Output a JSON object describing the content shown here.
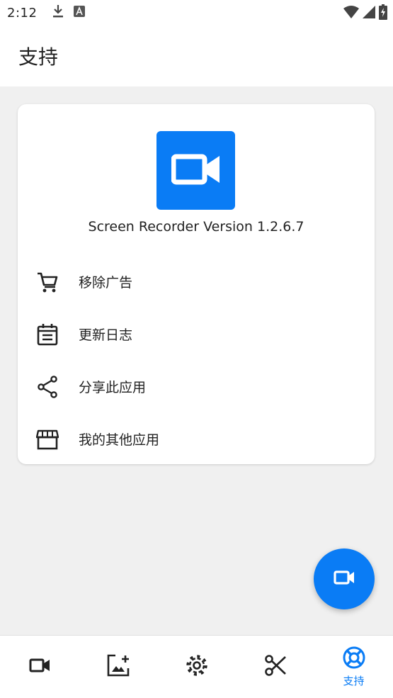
{
  "status_bar": {
    "time": "2:12",
    "icons": [
      "download-icon",
      "a-app-icon",
      "wifi-icon",
      "signal-icon",
      "battery-charging-icon"
    ]
  },
  "app_bar": {
    "title": "支持"
  },
  "card": {
    "app_icon": "video-camera-icon",
    "version_text": "Screen Recorder Version 1.2.6.7",
    "items": [
      {
        "label": "移除广告",
        "icon": "cart-icon"
      },
      {
        "label": "更新日志",
        "icon": "calendar-icon"
      },
      {
        "label": "分享此应用",
        "icon": "share-icon"
      },
      {
        "label": "我的其他应用",
        "icon": "store-icon"
      }
    ]
  },
  "fab": {
    "icon": "video-camera-icon"
  },
  "bottom_nav": {
    "items": [
      {
        "icon": "video-camera-icon",
        "label": ""
      },
      {
        "icon": "gallery-icon",
        "label": ""
      },
      {
        "icon": "settings-gear-icon",
        "label": ""
      },
      {
        "icon": "scissors-icon",
        "label": ""
      },
      {
        "icon": "support-lifebuoy-icon",
        "label": "支持",
        "active": true
      }
    ]
  },
  "colors": {
    "accent": "#0a7cf5",
    "background": "#f0f0f0",
    "surface": "#ffffff"
  }
}
